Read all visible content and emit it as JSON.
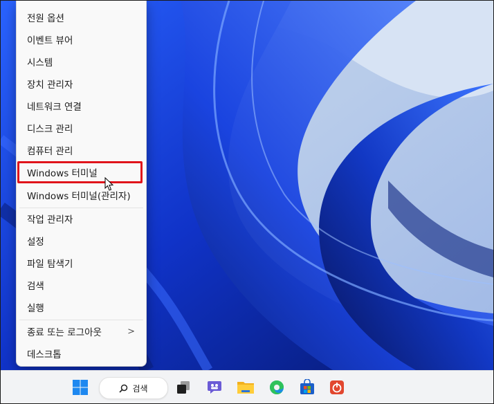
{
  "context_menu": {
    "items": [
      {
        "label": "전원 옵션"
      },
      {
        "label": "이벤트 뷰어"
      },
      {
        "label": "시스템"
      },
      {
        "label": "장치 관리자"
      },
      {
        "label": "네트워크 연결"
      },
      {
        "label": "디스크 관리"
      },
      {
        "label": "컴퓨터 관리"
      },
      {
        "label": "Windows 터미널"
      },
      {
        "label": "Windows 터미널(관리자)"
      },
      {
        "label": "작업 관리자"
      },
      {
        "label": "설정"
      },
      {
        "label": "파일 탐색기"
      },
      {
        "label": "검색"
      },
      {
        "label": "실행"
      },
      {
        "label": "종료 또는 로그아웃",
        "submenu_indicator": ">"
      },
      {
        "label": "데스크톱"
      }
    ],
    "highlighted_item": "Windows 터미널",
    "highlight_color": "#e0141b"
  },
  "taskbar": {
    "search_label": "검색",
    "icons": [
      "start-icon",
      "search-icon",
      "task-view-icon",
      "chat-icon",
      "file-explorer-icon",
      "edge-icon",
      "store-icon",
      "office-icon"
    ]
  },
  "colors": {
    "wallpaper_primary": "#1746d6",
    "wallpaper_dark": "#0a1f6e",
    "taskbar_bg": "#f2f3f5",
    "menu_bg": "#f9f9f9"
  }
}
